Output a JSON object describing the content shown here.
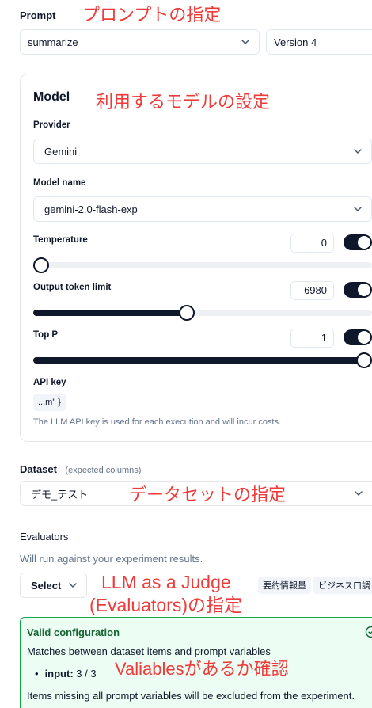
{
  "prompt": {
    "label": "Prompt",
    "selected": "summarize",
    "version": "Version 4"
  },
  "model_card": {
    "title": "Model",
    "provider": {
      "label": "Provider",
      "value": "Gemini"
    },
    "model_name": {
      "label": "Model name",
      "value": "gemini-2.0-flash-exp"
    },
    "temperature": {
      "label": "Temperature",
      "value": "0",
      "slider_fraction": 0.0,
      "enabled": true
    },
    "output_token_limit": {
      "label": "Output token limit",
      "value": "6980",
      "slider_fraction": 0.45,
      "enabled": true
    },
    "top_p": {
      "label": "Top P",
      "value": "1",
      "slider_fraction": 1.0,
      "enabled": true
    },
    "api_key": {
      "label": "API key",
      "chip": "...m\" }",
      "note": "The LLM API key is used for each execution and will incur costs."
    }
  },
  "dataset": {
    "label": "Dataset",
    "hint": "(expected columns)",
    "selected": "デモ_テスト"
  },
  "evaluators": {
    "label": "Evaluators",
    "description": "Will run against your experiment results.",
    "select_label": "Select",
    "chips": [
      "要約情報量",
      "ビジネス口調"
    ]
  },
  "validation": {
    "title": "Valid configuration",
    "subtitle": "Matches between dataset items and prompt variables",
    "item_key": "input:",
    "item_value": "3 / 3",
    "footer": "Items missing all prompt variables will be excluded from the experiment."
  },
  "annotations": {
    "prompt": "プロンプトの指定",
    "model": "利用するモデルの設定",
    "dataset": "データセットの指定",
    "evaluator_line1": "LLM as a Judge",
    "evaluator_line2": "(Evaluators)の指定",
    "variables": "Valiablesがあるか確認"
  },
  "colors": {
    "accent": "#0f172a",
    "annotation": "#ef3a3a",
    "valid_border": "#16a34a",
    "valid_bg": "#ecfdf3"
  }
}
